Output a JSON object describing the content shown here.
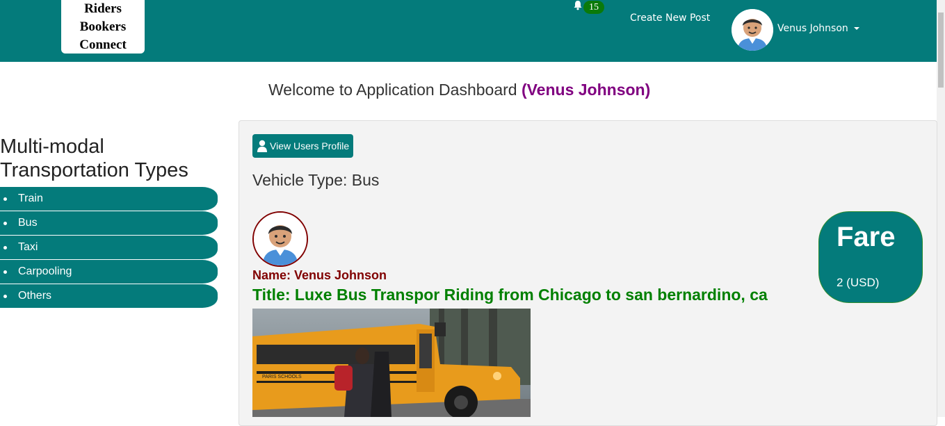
{
  "navbar": {
    "brand": "Riders Bookers Connect",
    "notification_count": "15",
    "create_post_label": "Create New Post",
    "user_name": "Venus Johnson",
    "accent_color": "#047b7b",
    "icons": [
      "bell-icon",
      "avatar",
      "caret-down-icon"
    ]
  },
  "welcome": {
    "text": "Welcome to Application Dashboard",
    "user_display": "(Venus Johnson)"
  },
  "sidebar": {
    "title": "Multi-modal Transportation Types",
    "items": [
      {
        "label": "Train"
      },
      {
        "label": "Bus"
      },
      {
        "label": "Taxi"
      },
      {
        "label": "Carpooling"
      },
      {
        "label": "Others"
      }
    ]
  },
  "main": {
    "profile_button_label": "View Users Profile",
    "vehicle_type": "Vehicle Type: Bus",
    "post": {
      "name": "Name: Venus Johnson",
      "title": "Title: Luxe Bus Transpor Riding from Chicago to san bernardino, ca",
      "image_label": "PARIS SCHOOLS"
    },
    "fare": {
      "label": "Fare",
      "value": "2 (USD)"
    }
  }
}
